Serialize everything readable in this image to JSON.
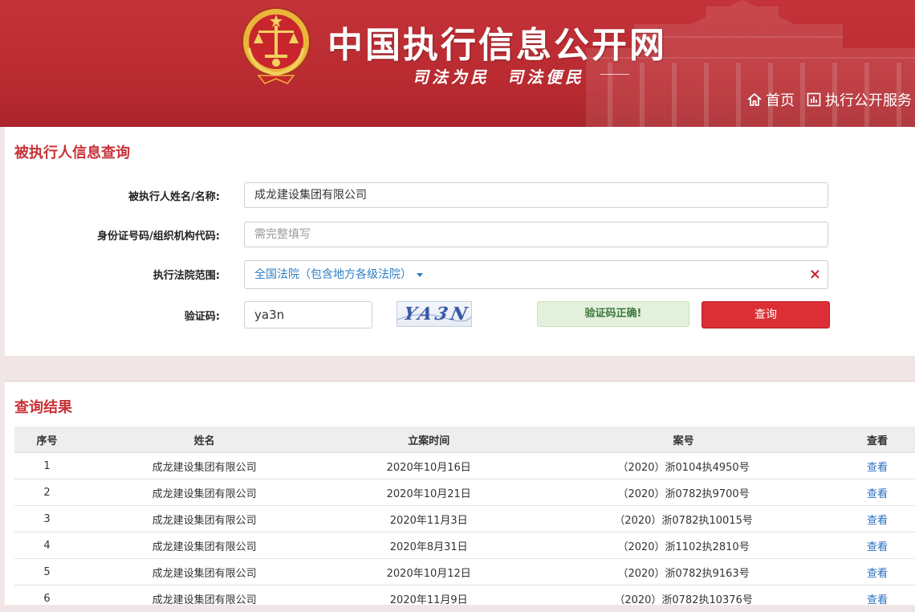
{
  "header": {
    "site_title": "中国执行信息公开网",
    "slogan_left": "司法为民",
    "slogan_right": "司法便民",
    "nav": [
      {
        "label": "首页",
        "icon": "home-icon"
      },
      {
        "label": "执行公开服务",
        "icon": "bar-chart-icon"
      }
    ]
  },
  "search": {
    "title": "被执行人信息查询",
    "name_label": "被执行人姓名/名称:",
    "name_value": "成龙建设集团有限公司",
    "id_label": "身份证号码/组织机构代码:",
    "id_placeholder": "需完整填写",
    "court_label": "执行法院范围:",
    "court_value": "全国法院（包含地方各级法院）",
    "clear_icon": "close-icon",
    "captcha_label": "验证码:",
    "captcha_value": "ya3n",
    "captcha_image_text": "YA3N",
    "captcha_status": "验证码正确!",
    "query_button": "查询"
  },
  "results": {
    "title": "查询结果",
    "columns": [
      "序号",
      "姓名",
      "立案时间",
      "案号",
      "查看"
    ],
    "rows": [
      {
        "no": "1",
        "name": "成龙建设集团有限公司",
        "date": "2020年10月16日",
        "case": "（2020）浙0104执4950号",
        "view": "查看"
      },
      {
        "no": "2",
        "name": "成龙建设集团有限公司",
        "date": "2020年10月21日",
        "case": "（2020）浙0782执9700号",
        "view": "查看"
      },
      {
        "no": "3",
        "name": "成龙建设集团有限公司",
        "date": "2020年11月3日",
        "case": "（2020）浙0782执10015号",
        "view": "查看"
      },
      {
        "no": "4",
        "name": "成龙建设集团有限公司",
        "date": "2020年8月31日",
        "case": "（2020）浙1102执2810号",
        "view": "查看"
      },
      {
        "no": "5",
        "name": "成龙建设集团有限公司",
        "date": "2020年10月12日",
        "case": "（2020）浙0782执9163号",
        "view": "查看"
      },
      {
        "no": "6",
        "name": "成龙建设集团有限公司",
        "date": "2020年11月9日",
        "case": "（2020）浙0782执10376号",
        "view": "查看"
      }
    ]
  },
  "colors": {
    "header_red": "#b72a30",
    "title_red": "#c83238",
    "button_red": "#db2e35",
    "link_blue": "#2a6fc0",
    "success_green": "#e3f1dc"
  }
}
